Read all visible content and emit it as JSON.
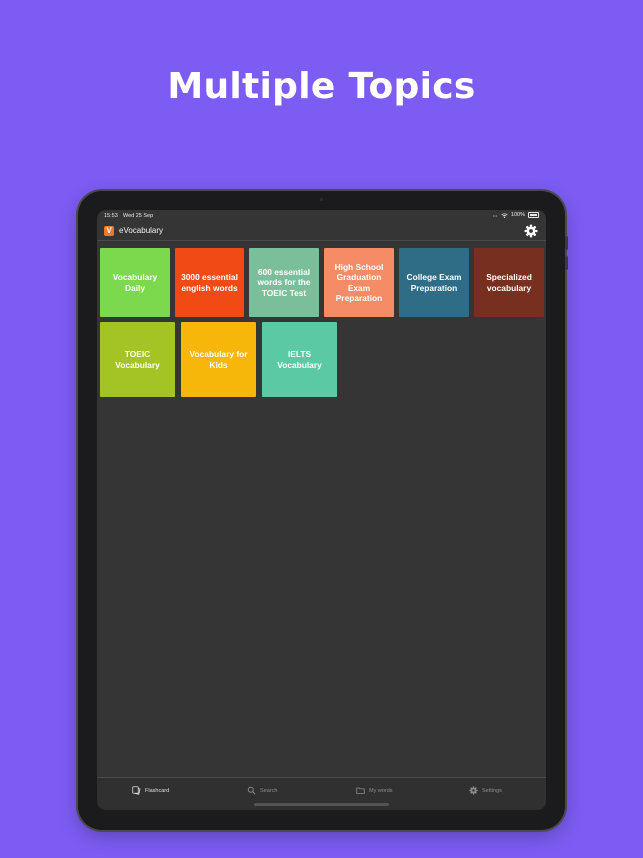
{
  "headline": "Multiple Topics",
  "status_bar": {
    "time": "15:53",
    "date": "Wed 25 Sep",
    "battery": "100%"
  },
  "app": {
    "logo_letter": "V",
    "title": "eVocabulary"
  },
  "topics": [
    {
      "label": "Vocabulary Daily",
      "color": "#7cd84c"
    },
    {
      "label": "3000 essential english words",
      "color": "#f24a14"
    },
    {
      "label": "600 essential words for the TOEIC Test",
      "color": "#7bbf9a"
    },
    {
      "label": "High School Graduation Exam Preparation",
      "color": "#f58c66"
    },
    {
      "label": "College Exam Preparation",
      "color": "#2f6c86"
    },
    {
      "label": "Specialized vocabulary",
      "color": "#773020"
    },
    {
      "label": "TOEIC Vocabulary",
      "color": "#a3c424"
    },
    {
      "label": "Vocabulary for Kids",
      "color": "#f6b60a"
    },
    {
      "label": "IELTS Vocabulary",
      "color": "#5ac9a4"
    }
  ],
  "tabs": [
    {
      "label": "Flashcard",
      "icon": "flashcard-icon",
      "active": true
    },
    {
      "label": "Search",
      "icon": "search-icon",
      "active": false
    },
    {
      "label": "My words",
      "icon": "folder-icon",
      "active": false
    },
    {
      "label": "Settings",
      "icon": "gear-icon",
      "active": false
    }
  ]
}
